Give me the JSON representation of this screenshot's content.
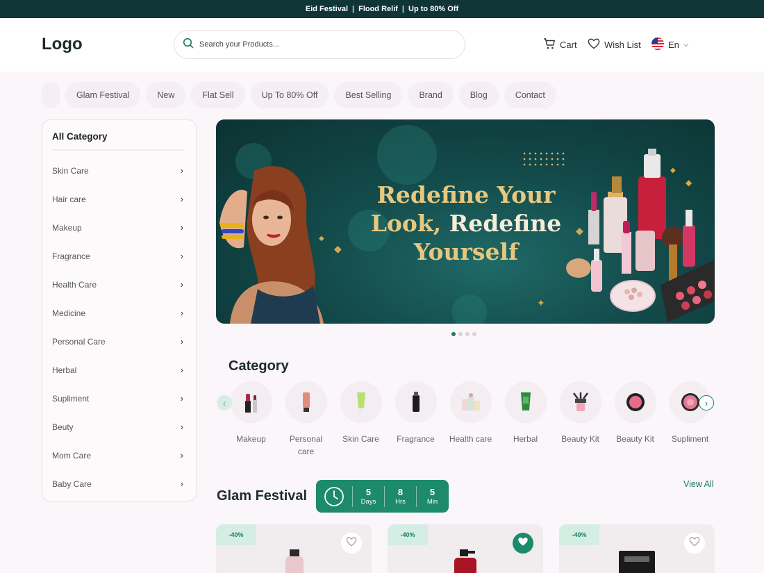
{
  "topbar": {
    "items": [
      "Eid Festival",
      "Flood Relif",
      "Up to 80% Off"
    ],
    "separator": "|"
  },
  "header": {
    "logo": "Logo",
    "search_placeholder": "Search your Products...",
    "cart_label": "Cart",
    "wishlist_label": "Wish List",
    "language_label": "En"
  },
  "nav": {
    "items": [
      "Glam Festival",
      "New",
      "Flat Sell",
      "Up To 80% Off",
      "Best Selling",
      "Brand",
      "Blog",
      "Contact"
    ]
  },
  "sidebar": {
    "title": "All Category",
    "items": [
      "Skin Care",
      "Hair care",
      "Makeup",
      "Fragrance",
      "Health Care",
      "Medicine",
      "Personal Care",
      "Herbal",
      "Supliment",
      "Beuty",
      "Mom Care",
      "Baby Care"
    ]
  },
  "banner": {
    "headline_line1": "Redefine Your",
    "headline_line2a": "Look, ",
    "headline_line2b": "Redefine",
    "headline_line3": "Yourself"
  },
  "category": {
    "title": "Category",
    "items": [
      {
        "label": "Makeup",
        "icon": "lipstick-icon"
      },
      {
        "label": "Personal care",
        "icon": "tube-icon"
      },
      {
        "label": "Skin Care",
        "icon": "cream-tube-icon"
      },
      {
        "label": "Fragrance",
        "icon": "perfume-icon"
      },
      {
        "label": "Health care",
        "icon": "health-kit-icon"
      },
      {
        "label": "Herbal",
        "icon": "herbal-tube-icon"
      },
      {
        "label": "Beauty Kit",
        "icon": "brush-set-icon"
      },
      {
        "label": "Beauty Kit",
        "icon": "compact-icon"
      },
      {
        "label": "Supliment",
        "icon": "compact-icon"
      }
    ]
  },
  "glam": {
    "title": "Glam Festival",
    "view_all": "View All",
    "timer": [
      {
        "value": "5",
        "unit": "Days"
      },
      {
        "value": "8",
        "unit": "Hrs"
      },
      {
        "value": "5",
        "unit": "Min"
      }
    ],
    "products": [
      {
        "discount": "-40%",
        "favorited": false
      },
      {
        "discount": "-40%",
        "favorited": true
      },
      {
        "discount": "-40%",
        "favorited": false
      }
    ]
  },
  "colors": {
    "primary": "#1d7a63",
    "topbar": "#0f3537",
    "accent_gold": "#e8c77e"
  }
}
